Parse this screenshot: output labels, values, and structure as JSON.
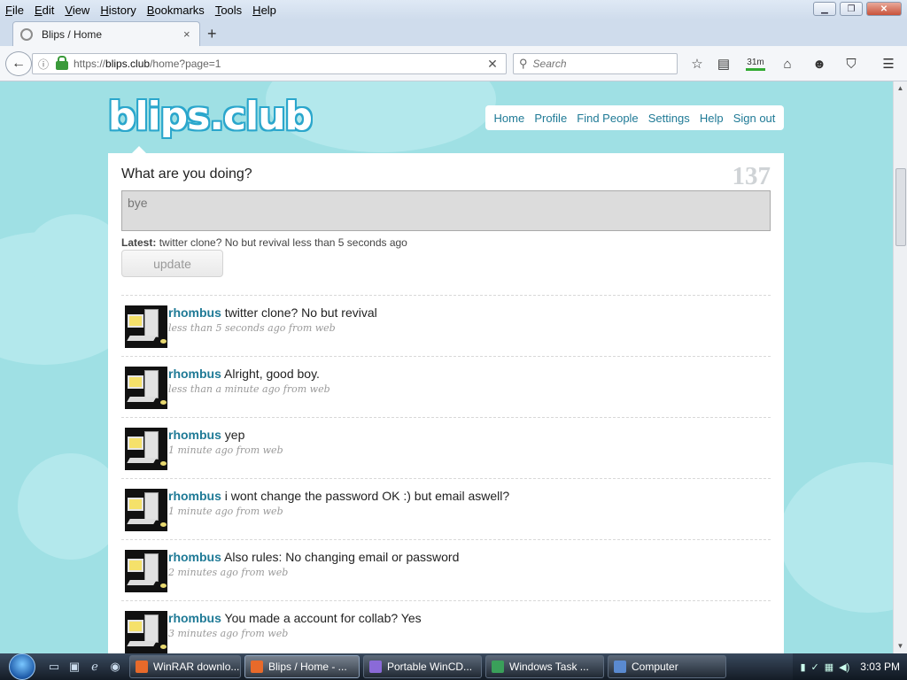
{
  "menubar": {
    "items": [
      "File",
      "Edit",
      "View",
      "History",
      "Bookmarks",
      "Tools",
      "Help"
    ]
  },
  "tab": {
    "title": "Blips / Home",
    "close": "×",
    "new": "+"
  },
  "address": {
    "prefix": "https://",
    "host": "blips.club",
    "path": "/home?page=1",
    "clear": "✕"
  },
  "search": {
    "placeholder": "Search"
  },
  "toolbar": {
    "badge": "31m"
  },
  "site": {
    "logo": "blips.club",
    "nav": [
      "Home",
      "Profile",
      "Find People",
      "Settings",
      "Help",
      "Sign out"
    ]
  },
  "composer": {
    "prompt": "What are you doing?",
    "char_count": "137",
    "value": "bye",
    "latest_label": "Latest:",
    "latest_text": "twitter clone? No but revival less than 5 seconds ago",
    "update_label": "update"
  },
  "posts": [
    {
      "user": "rhombus",
      "text": "twitter clone? No but revival",
      "meta": "less than 5 seconds ago from web"
    },
    {
      "user": "rhombus",
      "text": "Alright, good boy.",
      "meta": "less than a minute ago from web"
    },
    {
      "user": "rhombus",
      "text": "yep",
      "meta": "1 minute ago from web"
    },
    {
      "user": "rhombus",
      "text": "i wont change the password OK :) but email aswell?",
      "meta": "1 minute ago from web"
    },
    {
      "user": "rhombus",
      "text": "Also rules: No changing email or password",
      "meta": "2 minutes ago from web"
    },
    {
      "user": "rhombus",
      "text": "You made a account for collab? Yes",
      "meta": "3 minutes ago from web"
    }
  ],
  "taskbar": {
    "tasks": [
      "WinRAR downlo...",
      "Blips / Home - ...",
      "Portable WinCD...",
      "Windows Task ...",
      "Computer"
    ],
    "clock": "3:03 PM"
  },
  "colors": {
    "page_bg": "#9fe0e4",
    "link": "#1f7a96",
    "logo_outline": "#2aa6cc"
  }
}
